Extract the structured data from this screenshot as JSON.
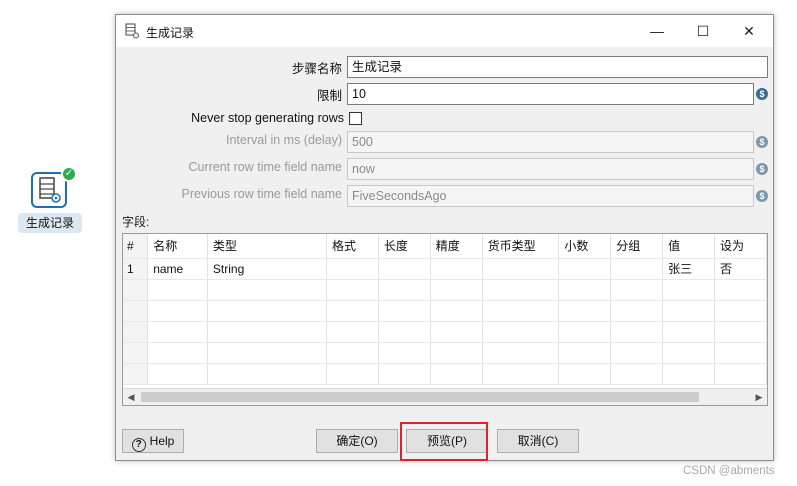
{
  "canvas": {
    "step_label": "生成记录",
    "step_icon": "data-grid-gear-icon",
    "step_status_icon": "check-icon"
  },
  "dialog": {
    "title": "生成记录",
    "title_icon": "data-grid-gear-icon",
    "window_buttons": {
      "minimize": "—",
      "maximize": "☐",
      "close": "✕"
    },
    "fields": {
      "step_name": {
        "label": "步骤名称",
        "value": "生成记录"
      },
      "limit": {
        "label": "限制",
        "value": "10"
      },
      "never_stop": {
        "label": "Never stop generating rows",
        "checked": false
      },
      "interval": {
        "label": "Interval in ms (delay)",
        "value": "500"
      },
      "current_time_field": {
        "label": "Current row time field name",
        "value": "now"
      },
      "previous_time_field": {
        "label": "Previous row time field name",
        "value": "FiveSecondsAgo"
      }
    },
    "variable_icon": "$",
    "fields_caption": "字段:",
    "grid": {
      "columns": [
        "#",
        "名称",
        "类型",
        "格式",
        "长度",
        "精度",
        "货币类型",
        "小数",
        "分组",
        "值",
        "设为"
      ],
      "rows": [
        [
          "1",
          "name",
          "String",
          "",
          "",
          "",
          "",
          "",
          "",
          "张三",
          "否"
        ]
      ]
    },
    "buttons": {
      "help": "Help",
      "ok": "确定(O)",
      "preview": "预览(P)",
      "cancel": "取消(C)"
    }
  },
  "colors": {
    "highlight": "#d8262d",
    "step_border": "#1f6fb2",
    "status_ok": "#2fa84f"
  },
  "watermark": "CSDN @abments"
}
